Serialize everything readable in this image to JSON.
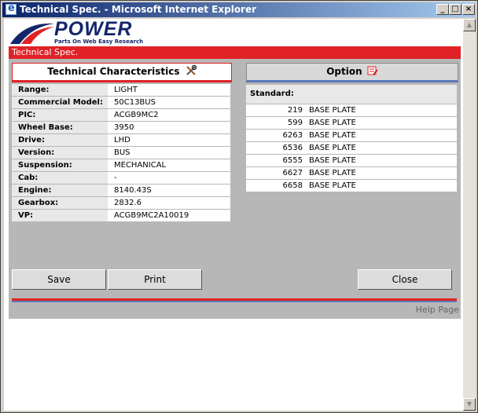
{
  "window": {
    "title": "Technical Spec. - Microsoft Internet Explorer",
    "minimize": "_",
    "maximize": "□",
    "close": "×"
  },
  "logo": {
    "brand": "POWER",
    "tagline": "Parts On Web Easy Research"
  },
  "header": {
    "title": "Technical Spec."
  },
  "tech": {
    "heading": "Technical Characteristics",
    "rows": [
      {
        "label": "Range:",
        "value": "LIGHT"
      },
      {
        "label": "Commercial Model:",
        "value": "50C13BUS"
      },
      {
        "label": "PIC:",
        "value": "ACGB9MC2"
      },
      {
        "label": "Wheel Base:",
        "value": "3950"
      },
      {
        "label": "Drive:",
        "value": "LHD"
      },
      {
        "label": "Version:",
        "value": "BUS"
      },
      {
        "label": "Suspension:",
        "value": "MECHANICAL"
      },
      {
        "label": "Cab:",
        "value": "-"
      },
      {
        "label": "Engine:",
        "value": "8140.43S"
      },
      {
        "label": "Gearbox:",
        "value": "2832.6"
      },
      {
        "label": "VP:",
        "value": "ACGB9MC2A10019"
      }
    ]
  },
  "option": {
    "heading": "Option",
    "standard_label": "Standard:",
    "rows": [
      {
        "code": "219",
        "desc": "BASE PLATE"
      },
      {
        "code": "599",
        "desc": "BASE PLATE"
      },
      {
        "code": "6263",
        "desc": "BASE PLATE"
      },
      {
        "code": "6536",
        "desc": "BASE PLATE"
      },
      {
        "code": "6555",
        "desc": "BASE PLATE"
      },
      {
        "code": "6627",
        "desc": "BASE PLATE"
      },
      {
        "code": "6658",
        "desc": "BASE PLATE"
      }
    ]
  },
  "buttons": {
    "save": "Save",
    "print": "Print",
    "close": "Close"
  },
  "footer": {
    "help": "Help Page"
  },
  "colors": {
    "accent_red": "#e02226",
    "title_blue": "#0a246a",
    "logo_navy": "#13266b"
  }
}
